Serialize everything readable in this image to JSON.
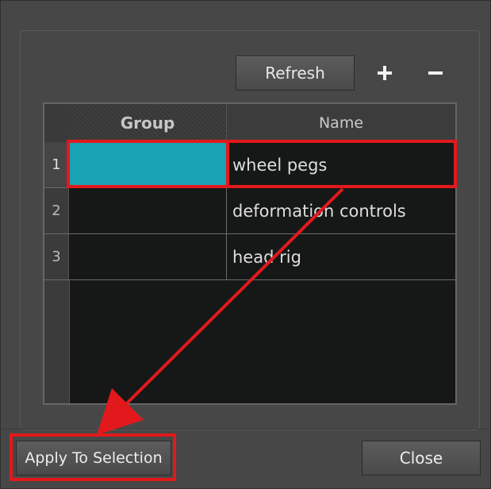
{
  "toolbar": {
    "refresh_label": "Refresh",
    "add_icon": "plus-icon",
    "remove_icon": "minus-icon"
  },
  "table": {
    "columns": [
      "Group",
      "Name"
    ],
    "rows": [
      {
        "index": "1",
        "group_color": "#17a3b4",
        "name": "wheel pegs"
      },
      {
        "index": "2",
        "group_color": "",
        "name": "deformation controls"
      },
      {
        "index": "3",
        "group_color": "",
        "name": "head rig"
      }
    ]
  },
  "footer": {
    "apply_label": "Apply To Selection",
    "close_label": "Close"
  },
  "colors": {
    "highlight": "#e1191c",
    "selected_group": "#17a3b4",
    "table_bg": "#151816",
    "panel_bg": "#474747"
  }
}
